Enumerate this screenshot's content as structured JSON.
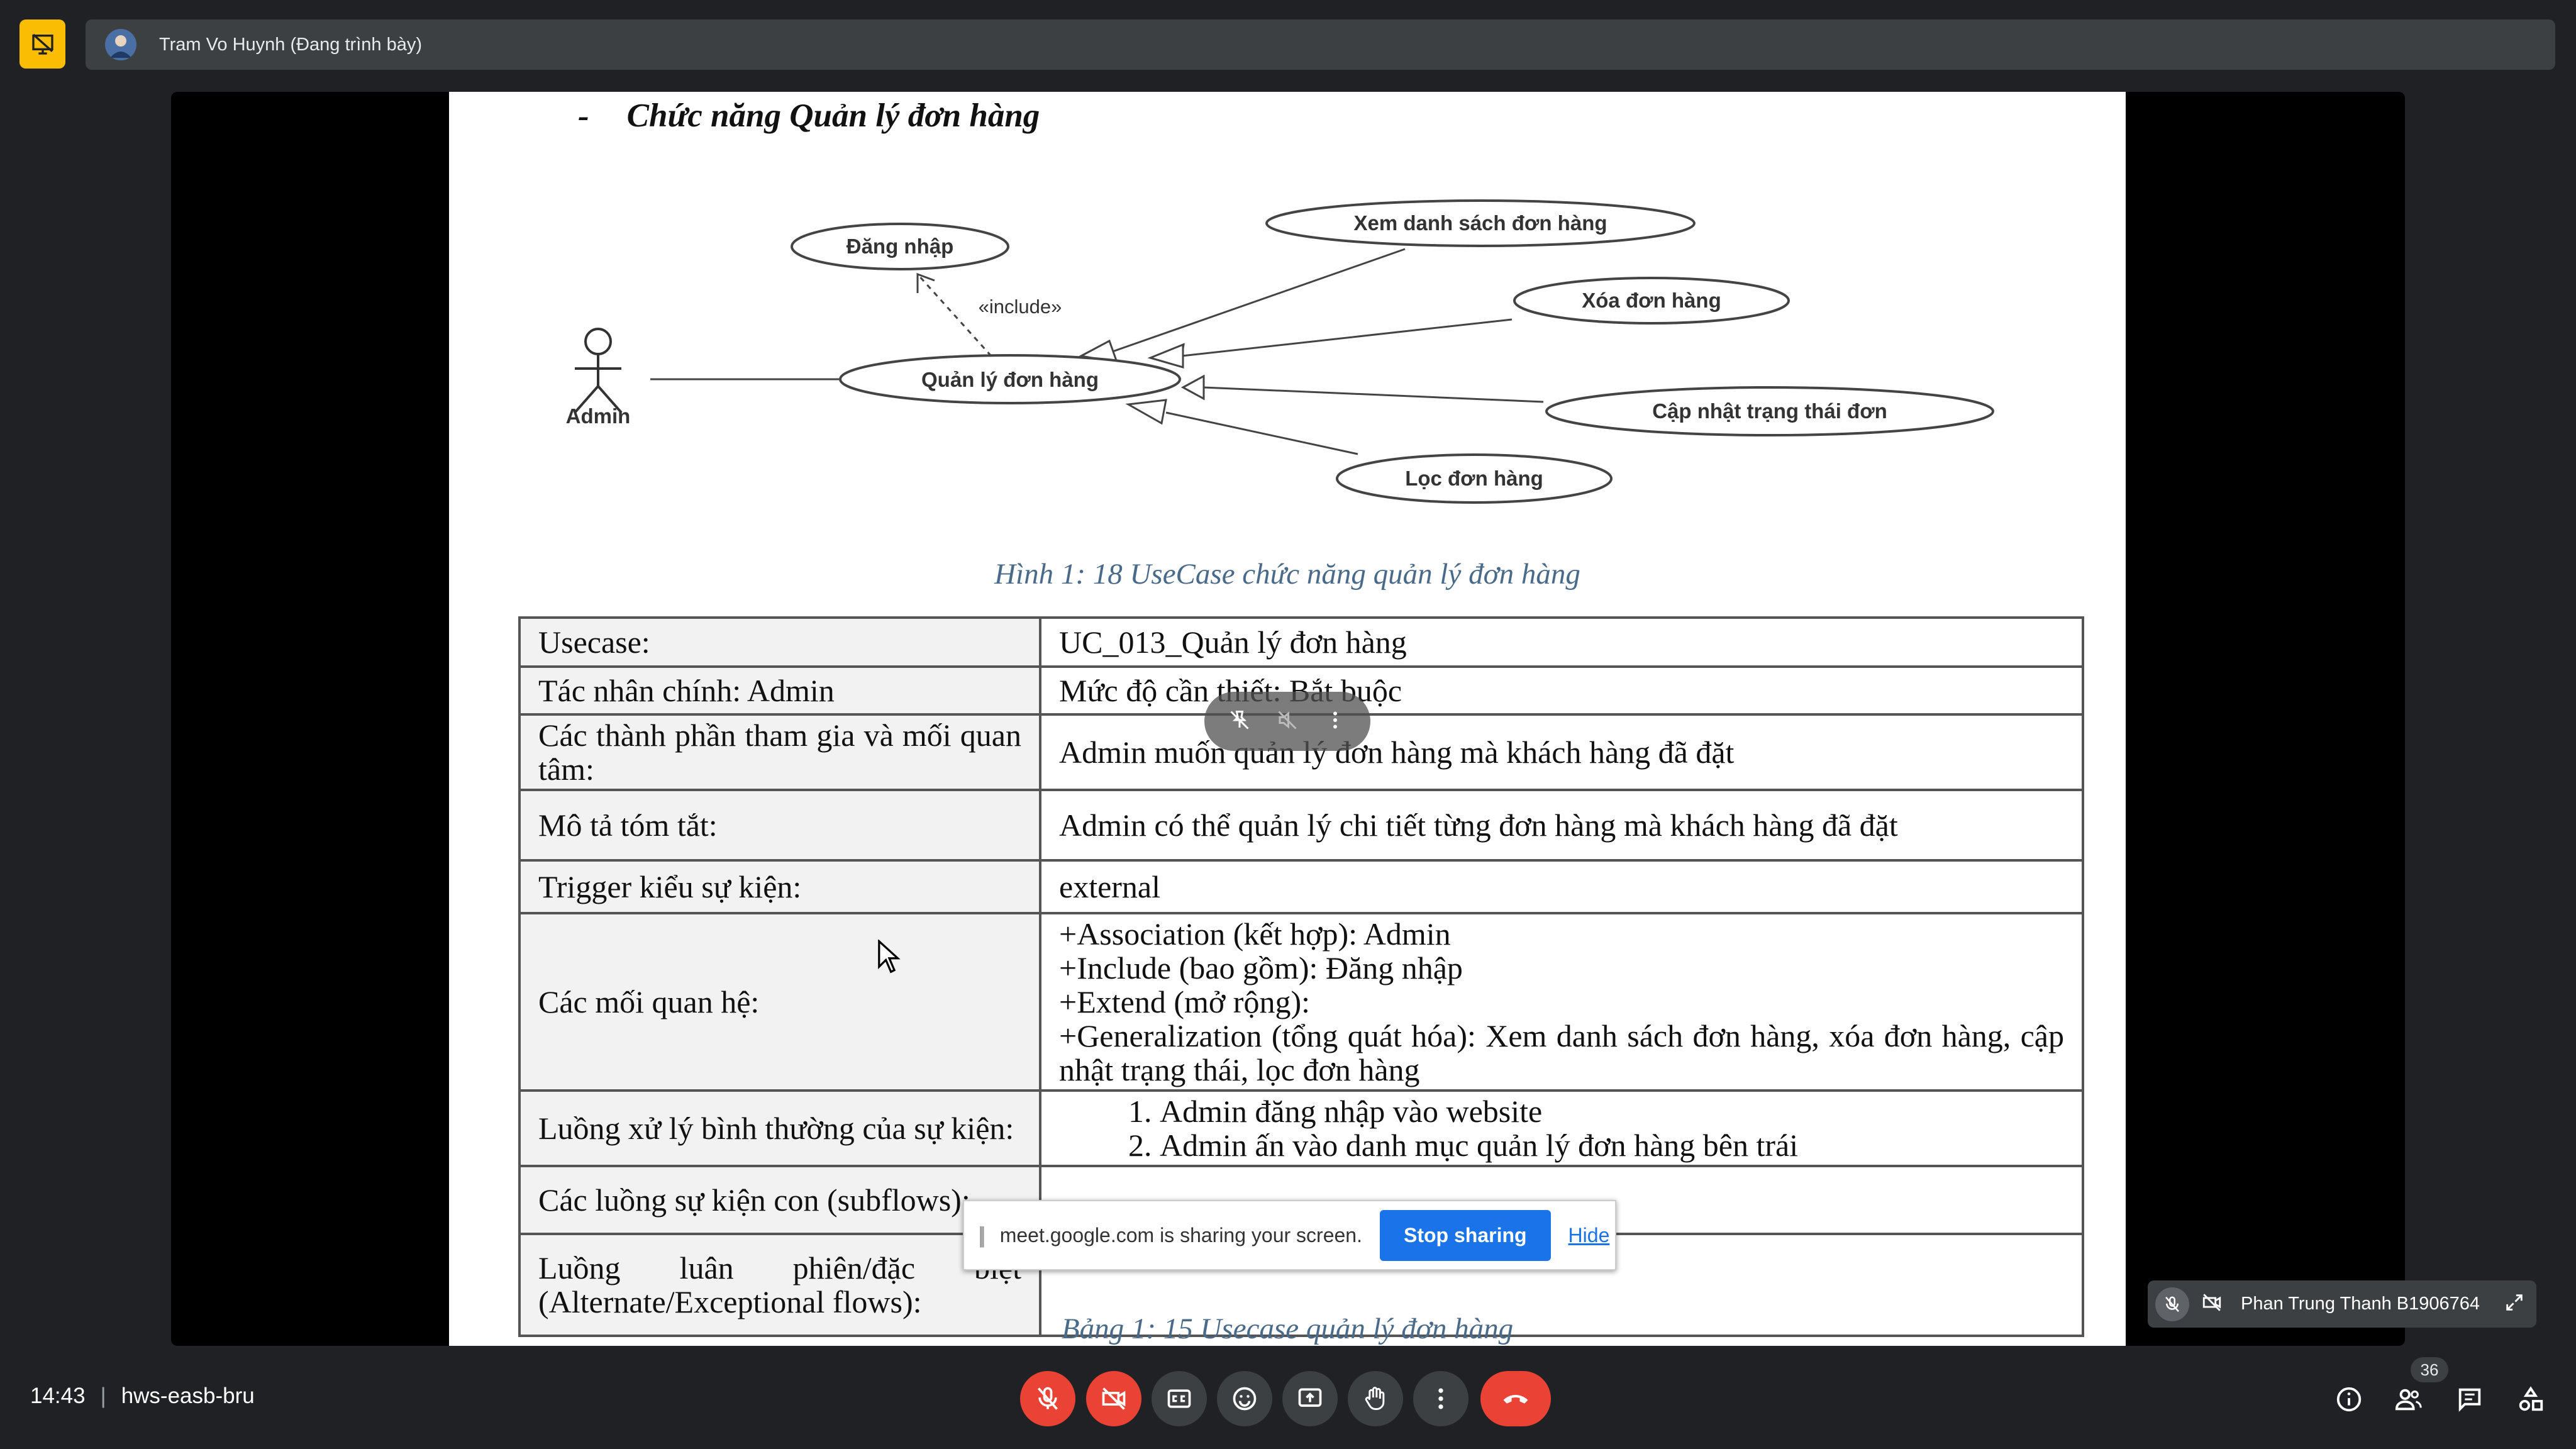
{
  "top_bar": {
    "present_icon": "presentation-off-icon",
    "presenter_title": "Tram Vo Huynh (Đang trình bày)"
  },
  "document": {
    "heading_dash": "-",
    "heading": "Chức năng Quản lý đơn hàng",
    "diagram": {
      "actor": "Admin",
      "main_usecase": "Quản lý đơn hàng",
      "include_usecase": "Đăng nhập",
      "include_label": "«include»",
      "child_usecases": [
        "Xem danh sách đơn hàng",
        "Xóa đơn hàng",
        "Cập nhật trạng thái đơn",
        "Lọc đơn hàng"
      ]
    },
    "figure_caption": "Hình 1: 18 UseCase chức năng quản lý đơn hàng",
    "table": {
      "rows": [
        {
          "label": "Usecase:",
          "value": "UC_013_Quản lý đơn hàng"
        },
        {
          "label": "Tác nhân chính: Admin",
          "value": "Mức độ cần thiết: Bắt buộc"
        },
        {
          "label": "Các thành phần tham gia và mối quan tâm:",
          "value": "Admin muốn quản lý đơn hàng mà khách hàng đã đặt"
        },
        {
          "label": "Mô tả tóm tắt:",
          "value": "Admin có thể quản lý chi tiết từng đơn hàng mà khách hàng đã đặt"
        },
        {
          "label": "Trigger kiểu sự kiện:",
          "value": "external"
        },
        {
          "label": "Các mối quan hệ:",
          "lines": [
            "+Association (kết hợp): Admin",
            "+Include (bao gồm): Đăng nhập",
            "+Extend (mở rộng):",
            "+Generalization (tổng quát hóa): Xem danh sách đơn hàng, xóa đơn hàng, cập nhật trạng thái, lọc đơn hàng"
          ]
        },
        {
          "label": "Luồng xử lý bình thường của sự kiện:",
          "steps": [
            "Admin đăng nhập vào website",
            "Admin ấn vào danh mục quản lý đơn hàng bên trái"
          ]
        },
        {
          "label": "Các luồng sự kiện con (subflows):",
          "value": ""
        },
        {
          "label": "Luồng luân phiên/đặc biệt (Alternate/Exceptional flows):",
          "value": ""
        }
      ]
    },
    "table_caption": "Bảng 1: 15 Usecase quản lý đơn hàng"
  },
  "share_banner": {
    "message": "meet.google.com is sharing your screen.",
    "stop_label": "Stop sharing",
    "hide_label": "Hide"
  },
  "participant_tile": {
    "name": "Phan Trung Thanh B1906764"
  },
  "bottom_bar": {
    "time": "14:43",
    "separator": "|",
    "meeting_code": "hws-easb-bru",
    "participant_count": "36"
  },
  "colors": {
    "background": "#202124",
    "bar": "#3c4043",
    "present_icon": "#fbbc04",
    "danger": "#ea4335",
    "link": "#1a73e8"
  }
}
